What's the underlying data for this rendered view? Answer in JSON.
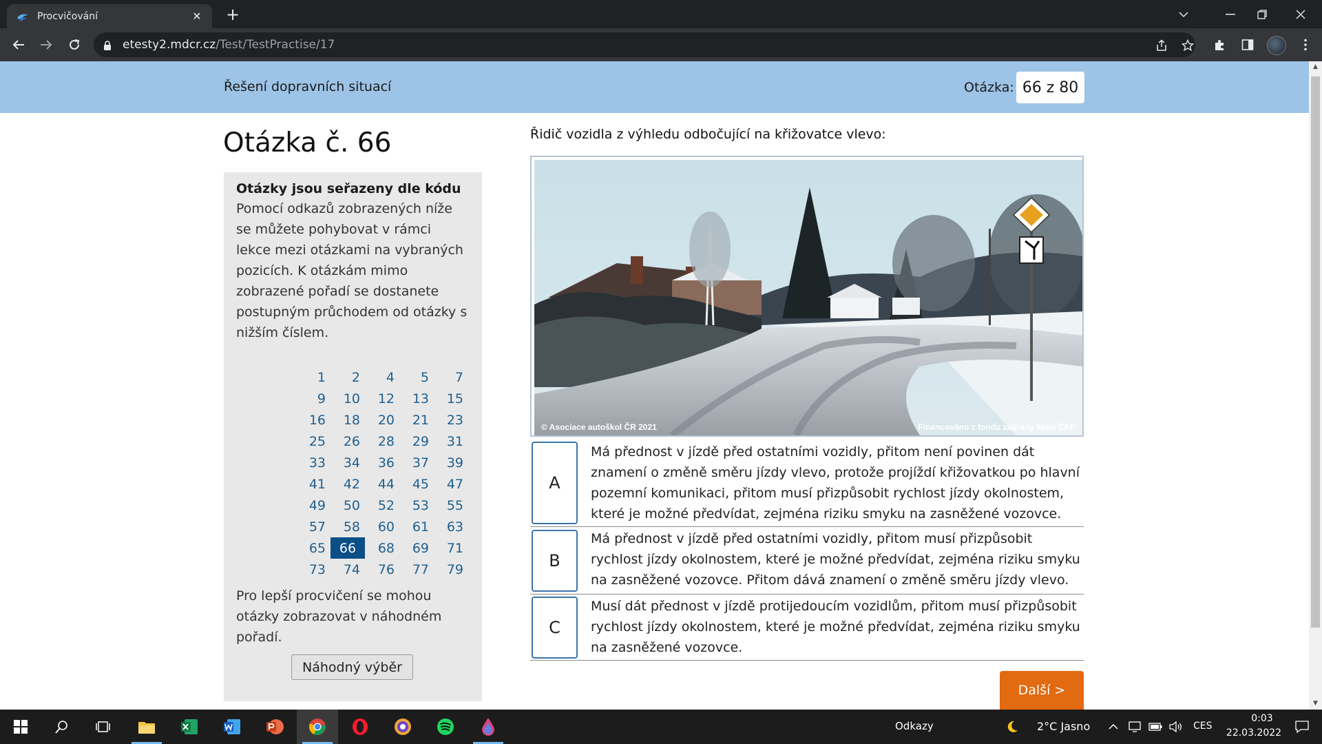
{
  "browser": {
    "tab_title": "Procvičování",
    "tab_close": "✕",
    "new_tab": "+",
    "url_host": "etesty2.mdcr.cz",
    "url_path": "/Test/TestPractise/17"
  },
  "header": {
    "subtitle": "Řešení dopravních situací",
    "question_label": "Otázka:",
    "question_counter": "66 z 80"
  },
  "heading": "Otázka č. 66",
  "sidebar": {
    "title": "Otázky jsou seřazeny dle kódu",
    "text": "Pomocí odkazů zobrazených níže se můžete pohybovat v rámci lekce mezi otázkami na vybraných pozicích. K otázkám mimo zobrazené pořadí se dostanete postupným průchodem od otázky s nižším číslem.",
    "numbers": [
      "1",
      "2",
      "4",
      "5",
      "7",
      "9",
      "10",
      "12",
      "13",
      "15",
      "16",
      "18",
      "20",
      "21",
      "23",
      "25",
      "26",
      "28",
      "29",
      "31",
      "33",
      "34",
      "36",
      "37",
      "39",
      "41",
      "42",
      "44",
      "45",
      "47",
      "49",
      "50",
      "52",
      "53",
      "55",
      "57",
      "58",
      "60",
      "61",
      "63",
      "65",
      "66",
      "68",
      "69",
      "71",
      "73",
      "74",
      "76",
      "77",
      "79"
    ],
    "active_number": "66",
    "bottom_text": "Pro lepší procvičení se mohou otázky zobrazovat v náhodném pořadí.",
    "random_button": "Náhodný výběr"
  },
  "question": {
    "text": "Řidič vozidla z výhledu odbočující na křižovatce vlevo:",
    "photo_credit_left": "© Asociace autoškol ČR 2021",
    "photo_credit_right": "Financováno z fondu zábrany škod ČKP"
  },
  "answers": [
    {
      "letter": "A",
      "text": "Má přednost v jízdě před ostatními vozidly, přitom není povinen dát znamení o změně směru jízdy vlevo, protože projíždí křižovatkou po hlavní pozemní komunikaci, přitom musí přizpůsobit rychlost jízdy okolnostem, které je možné předvídat, zejména riziku smyku na zasněžené vozovce."
    },
    {
      "letter": "B",
      "text": "Má přednost v jízdě před ostatními vozidly, přitom musí přizpůsobit rychlost jízdy okolnostem, které je možné předvídat, zejména riziku smyku na zasněžené vozovce. Přitom dává znamení o změně směru jízdy vlevo."
    },
    {
      "letter": "C",
      "text": "Musí dát přednost v jízdě protijedoucím vozidlům, přitom musí přizpůsobit rychlost jízdy okolnostem, které je možné předvídat, zejména riziku smyku na zasněžené vozovce."
    }
  ],
  "next_button": "Další >",
  "taskbar": {
    "links_label": "Odkazy",
    "weather": "2°C  Jasno",
    "language": "CES",
    "time": "0:03",
    "date": "22.03.2022"
  },
  "colors": {
    "header_bg": "#9dc3e6",
    "active_number_bg": "#0b4f87",
    "next_button_bg": "#e26a10",
    "answer_border": "#3b74a8"
  }
}
